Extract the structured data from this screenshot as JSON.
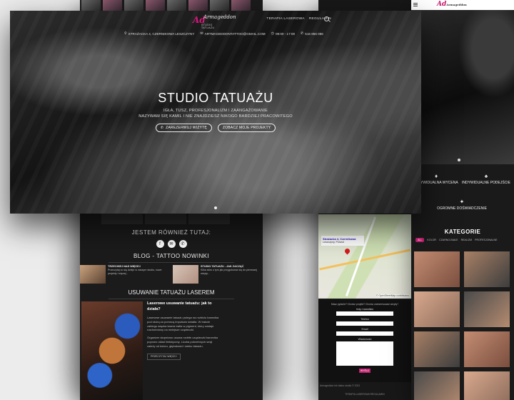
{
  "hero": {
    "logo_mark": "Ad",
    "logo_script": "Armageddon",
    "logo_sub": "STUDIO TATUAŻU",
    "menu": [
      "TERAPIA LASEROWA",
      "REGULAMIN"
    ],
    "contact": {
      "address": "STRAŻACKA 4, CZERNIKOWA LESZCZYNY",
      "email": "ARTMAGEDDONTATTOO@GMAIL.COM",
      "hours": "09:00 - 17:00",
      "phone": "516 856 086"
    },
    "title": "STUDIO TATUAŻU",
    "subtitle_line1": "IGŁA, TUSZ, PROFESJONALIZM I ZAANGAŻOWANIE",
    "subtitle_line2": "NAZYWAM SIĘ KAMIL I NIE ZNAJDZIESZ NIKOGO BARDZIEJ PRACOWITEGO",
    "btn_book": "ZAREZERWUJ WIZYTĘ",
    "btn_projects": "ZOBACZ MOJE PROJEKTY"
  },
  "left": {
    "also_here": "JESTEM RÓWNIEŻ TUTAJ:",
    "blog_heading": "BLOG - TATTOO NOWINKI",
    "blog_cards": [
      {
        "title": "TRZECHIEJ NAS WIĘCEJ",
        "text": "Przeczytaj co się dzieje w naszym studiu, nowe projekty i więcej..."
      },
      {
        "title": "STUDIO TATUAŻU - JAK ZACZĄĆ",
        "text": "Kilka słów o tym jak przygotować się do pierwszej wizyty..."
      }
    ],
    "laser_heading": "USUWANIE TATUAŻU LASEREM",
    "laser_title": "Laserowe usuwanie tatuażu: jak to działa?",
    "laser_p1": "Laserowe usuwanie tatuażu polega na rozbiciu barwnika pod skórą za pomocą impulsów światła. W trakcie zabiegu wiązka lasera trafia w pigment, który zostaje rozdrobniony na mniejsze cząsteczki.",
    "laser_p2": "Organizm stopniowo usuwa rozbite cząsteczki barwnika poprzez układ limfatyczny. Liczba potrzebnych sesji zależy od koloru, głębokości i wieku tatuażu.",
    "laser_more": "PRZECZYTAJ WIĘCEJ"
  },
  "middle": {
    "map_place": "Strażacka 4, Czernikowa",
    "map_sub": "Leszczyny, Poland",
    "map_attr": "© OpenStreetMap contributors",
    "form_question": "Masz pytanie? Chcesz projekt? Chcesz zarezerwować wizytę?",
    "form_name": "Imię i nazwisko",
    "form_phone": "Telefon",
    "form_email": "Email",
    "form_message": "Wiadomość",
    "form_send": "WYŚLIJ",
    "footer1": "Armageddon Ink tattoo studio © 2021",
    "footer2": "TERAPIA LASEROWA   REGULAMIN"
  },
  "right": {
    "features": [
      {
        "icon": "♦",
        "label": "INDYWIDUALNA WYCENA"
      },
      {
        "icon": "♠",
        "label": "INDYWIDUALNE PODEJŚCIE"
      },
      {
        "icon": "✦",
        "label": "OGROMNE DOŚWIADCZENIE"
      }
    ],
    "categories_heading": "KATEGORIE",
    "filters": [
      "ALL",
      "KOLOR",
      "CZARNO-BIAŁE",
      "REALIZM",
      "PROFESJONALNE"
    ]
  }
}
